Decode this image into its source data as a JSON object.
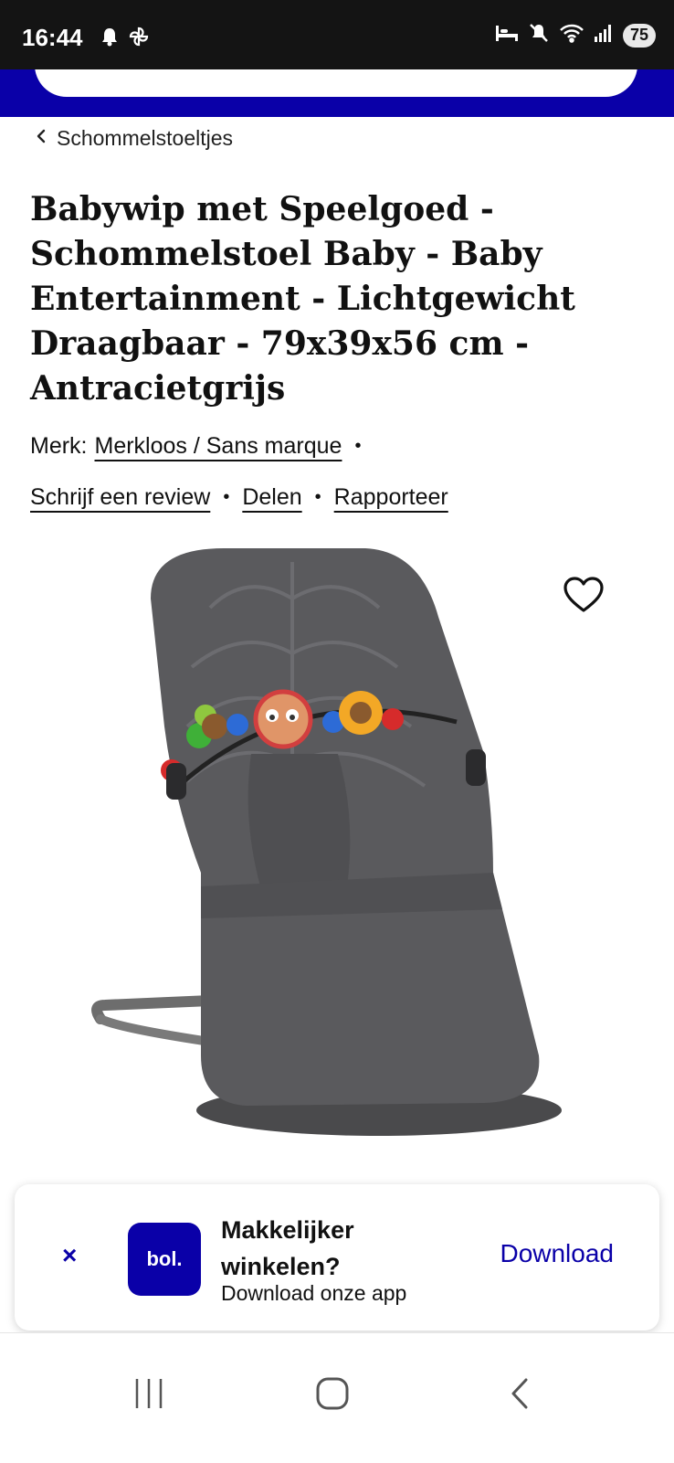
{
  "status_bar": {
    "time": "16:44",
    "battery": "75",
    "icons": [
      "bell-icon",
      "pinwheel-icon",
      "bed-icon",
      "mute-icon",
      "wifi-icon",
      "signal-icon",
      "battery-icon"
    ]
  },
  "breadcrumb": {
    "label": "Schommelstoeltjes",
    "icon": "chevron-left-icon"
  },
  "product": {
    "title": "Babywip met Speelgoed - Schommelstoel Baby - Baby Entertainment - Lichtgewicht Draagbaar - 79x39x56 cm - Antracietgrijs",
    "brand_label": "Merk:",
    "brand_name": "Merkloos / Sans marque",
    "actions": {
      "review": "Schrijf een review",
      "share": "Delen",
      "report": "Rapporteer"
    },
    "separator": "•",
    "image_description_icon": "baby-bouncer-image",
    "favorite_icon": "heart-icon"
  },
  "app_banner": {
    "close": "×",
    "logo": "bol.",
    "title": "Makkelijker winkelen?",
    "subtitle": "Download onze app",
    "cta": "Download"
  },
  "colors": {
    "brand_blue": "#0a00a8",
    "status_bar": "#141414",
    "text": "#111111"
  }
}
